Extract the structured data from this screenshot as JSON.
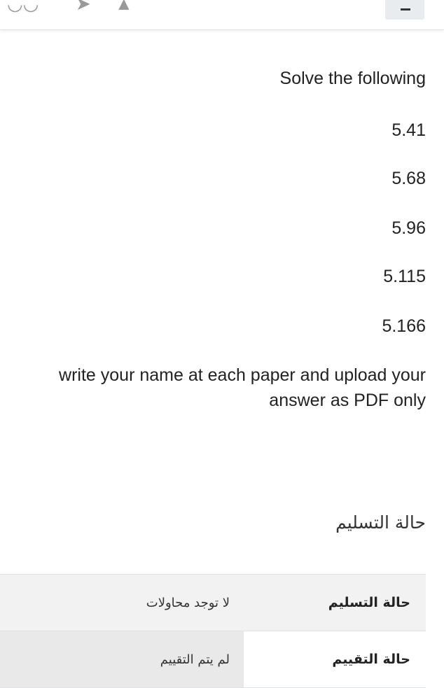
{
  "header": {
    "icons": [
      "user-icon",
      "chat-icon",
      "bell-icon"
    ],
    "menu_icon": "hamburger-menu-icon"
  },
  "assignment": {
    "intro": "Solve the following",
    "problems": [
      "5.41",
      "5.68",
      "5.96",
      "5.115",
      "5.166"
    ],
    "instructions_line1": "write your name at each paper and upload your",
    "instructions_line2": "answer as PDF only"
  },
  "submission_status": {
    "heading": "حالة التسليم",
    "rows": [
      {
        "label": "حالة التسليم",
        "value": "لا توجد محاولات"
      },
      {
        "label": "حالة التقييم",
        "value": "لم يتم التقييم"
      }
    ]
  },
  "colors": {
    "row_shade": "#f2f2f2",
    "grading_value_shade": "#e9e9e9",
    "menu_button_bg": "#e9ecef"
  }
}
